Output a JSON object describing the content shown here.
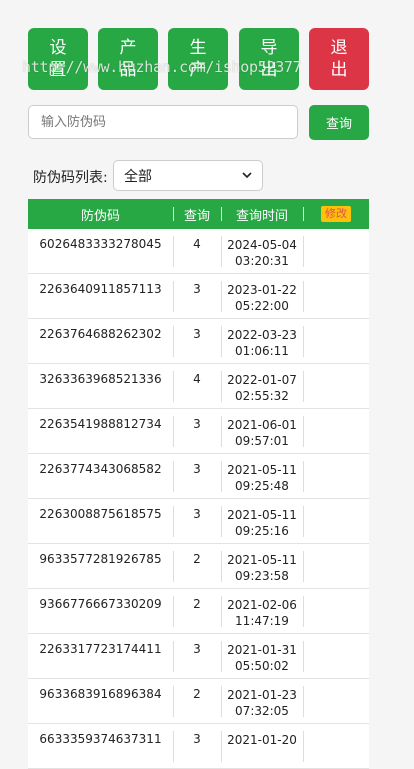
{
  "top_buttons": [
    {
      "label": "设置",
      "color": "#28a745"
    },
    {
      "label": "产品",
      "color": "#28a745"
    },
    {
      "label": "生产",
      "color": "#28a745"
    },
    {
      "label": "导出",
      "color": "#28a745"
    },
    {
      "label": "退出",
      "color": "#dc3545"
    }
  ],
  "watermark": "http://www.huzhan.com/ishop52377",
  "search": {
    "placeholder": "输入防伪码",
    "button_label": "查询"
  },
  "filter": {
    "label": "防伪码列表:",
    "selected": "全部"
  },
  "table": {
    "headers": {
      "code": "防伪码",
      "count": "查询",
      "time": "查询时间",
      "action": "修改"
    },
    "rows": [
      {
        "code": "6026483333278045",
        "count": "4",
        "date": "2024-05-04",
        "time": "03:20:31"
      },
      {
        "code": "2263640911857113",
        "count": "3",
        "date": "2023-01-22",
        "time": "05:22:00"
      },
      {
        "code": "2263764688262302",
        "count": "3",
        "date": "2022-03-23",
        "time": "01:06:11"
      },
      {
        "code": "3263363968521336",
        "count": "4",
        "date": "2022-01-07",
        "time": "02:55:32"
      },
      {
        "code": "2263541988812734",
        "count": "3",
        "date": "2021-06-01",
        "time": "09:57:01"
      },
      {
        "code": "2263774343068582",
        "count": "3",
        "date": "2021-05-11",
        "time": "09:25:48"
      },
      {
        "code": "2263008875618575",
        "count": "3",
        "date": "2021-05-11",
        "time": "09:25:16"
      },
      {
        "code": "9633577281926785",
        "count": "2",
        "date": "2021-05-11",
        "time": "09:23:58"
      },
      {
        "code": "9366776667330209",
        "count": "2",
        "date": "2021-02-06",
        "time": "11:47:19"
      },
      {
        "code": "2263317723174411",
        "count": "3",
        "date": "2021-01-31",
        "time": "05:50:02"
      },
      {
        "code": "9633683916896384",
        "count": "2",
        "date": "2021-01-23",
        "time": "07:32:05"
      },
      {
        "code": "6633359374637311",
        "count": "3",
        "date": "2021-01-20",
        "time": ""
      }
    ]
  }
}
